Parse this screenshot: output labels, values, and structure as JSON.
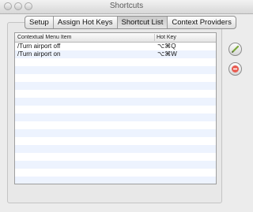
{
  "window": {
    "title": "Shortcuts"
  },
  "tabs": [
    {
      "label": "Setup"
    },
    {
      "label": "Assign Hot Keys"
    },
    {
      "label": "Shortcut List",
      "selected": true
    },
    {
      "label": "Context Providers"
    }
  ],
  "table": {
    "columns": [
      "Contextual Menu Item",
      "Hot Key"
    ],
    "rows": [
      {
        "item": "/Turn airport off",
        "hotkey": "⌥⌘Q"
      },
      {
        "item": "/Turn airport on",
        "hotkey": "⌥⌘W"
      }
    ]
  },
  "side_buttons": {
    "edit_icon": "pencil-icon",
    "remove_icon": "minus-icon"
  },
  "colors": {
    "alt_row": "#edf3fe",
    "chrome": "#ececec"
  }
}
